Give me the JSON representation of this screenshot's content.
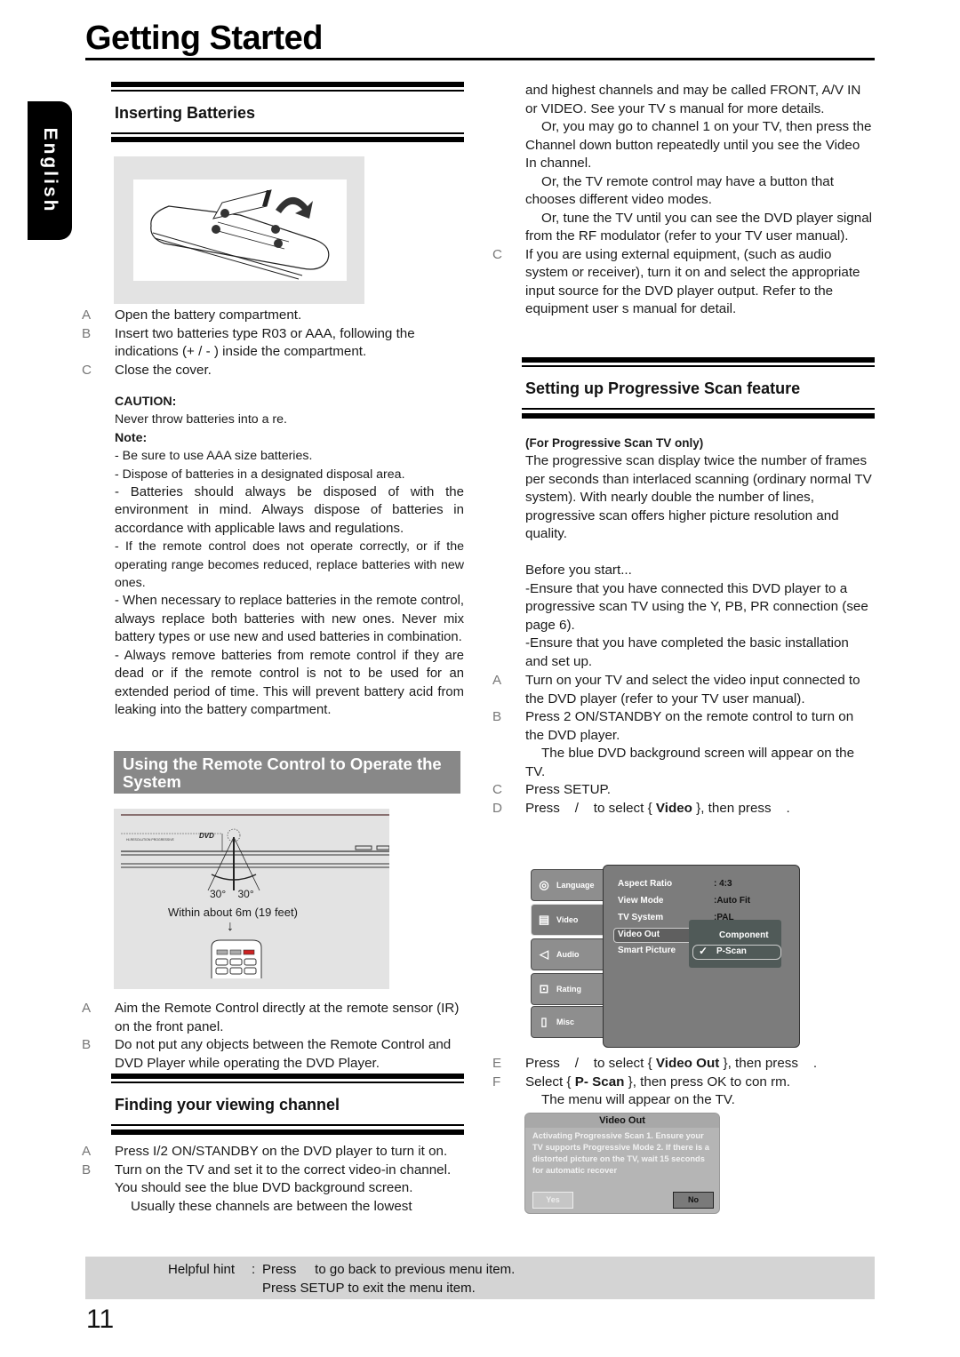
{
  "page": {
    "title": "Getting Started",
    "language_tab": "English",
    "page_number": "11"
  },
  "batteries": {
    "heading": "Inserting Batteries",
    "steps": [
      {
        "letter": "A",
        "text": "Open the battery compartment."
      },
      {
        "letter": "B",
        "text": "Insert two batteries type R03 or AAA, following the indications (+ / - ) inside the compartment."
      },
      {
        "letter": "C",
        "text": "Close the cover."
      }
    ],
    "caution_label": "CAUTION:",
    "caution_text": "Never throw batteries into a  re.",
    "note_label": "Note:",
    "notes": [
      "- Be sure to use AAA size batteries.",
      "- Dispose of batteries in a designated disposal area.",
      "- Batteries should always be disposed of with the environment in mind. Always dispose of batteries in accordance with applicable laws and regulations.",
      "- If the remote control does not operate correctly, or if the operating range becomes reduced, replace batteries with new ones.",
      "- When necessary to replace batteries in the remote control, always replace both batteries with new ones. Never mix battery types or use new and used batteries in combination.",
      "- Always remove batteries from remote control if they are dead or if the remote control is not to be used for an extended period of time. This will prevent battery acid from leaking into the battery compartment."
    ]
  },
  "remote": {
    "heading": "Using the Remote Control to Operate the System",
    "figure": {
      "angle_left": "30°",
      "angle_right": "30°",
      "distance": "Within about 6m (19 feet)",
      "arrow": "↓",
      "panel_brand": "HI-RESOLUTION PROGRESSIVE",
      "panel_logo": "DVD"
    },
    "steps": [
      {
        "letter": "A",
        "text": "Aim the Remote Control directly at the remote sensor (IR) on the front panel."
      },
      {
        "letter": "B",
        "text": "Do not put any objects between the Remote Control and DVD Player while operating the DVD Player."
      }
    ]
  },
  "channel": {
    "heading": "Finding your viewing channel",
    "steps": [
      {
        "letter": "A",
        "text": "Press I/2  ON/STANDBY on the DVD player to turn it on."
      },
      {
        "letter": "B",
        "text": "Turn on the TV and set it to the correct video-in channel. You should see the blue DVD background screen."
      }
    ],
    "continued": [
      "Usually these channels are between the lowest",
      "and highest channels and may be called FRONT, A/V IN or VIDEO. See your TV  s manual for more details.",
      "Or, you may go to channel 1 on your TV, then press the Channel down button repeatedly until you see the Video In channel.",
      "Or, the TV remote control may have a button that chooses different video modes.",
      "Or, tune the TV until you can see the DVD player signal from the RF modulator (refer to your TV user manual)."
    ],
    "step_c": {
      "letter": "C",
      "text": "If you are using external equipment, (such as audio  system or receiver), turn it on and select the appropriate input source for the DVD player output. Refer to the equipment user  s manual for detail."
    }
  },
  "progressive": {
    "heading": "Setting up Progressive Scan feature",
    "subheading": "(For Progressive Scan TV only)",
    "intro": "The progressive scan display twice the number of frames per seconds than interlaced scanning (ordinary normal TV system). With nearly double the number of lines, progressive scan offers higher picture resolution and quality.",
    "before_label": "Before you start...",
    "before": [
      "-Ensure that you have connected this DVD player to a progressive scan TV using the Y, PB, PR connection (see page 6).",
      "-Ensure that you have completed the basic installation and set up."
    ],
    "steps": [
      {
        "letter": "A",
        "text": "Turn on your TV and select the video input connected to the DVD player (refer to your TV user manual)."
      },
      {
        "letter": "B",
        "text": "Press 2  ON/STANDBY on the remote control to turn on the DVD player."
      },
      {
        "letter": "",
        "text": "The blue DVD background screen will appear on the TV."
      },
      {
        "letter": "C",
        "text": "Press SETUP."
      },
      {
        "letter": "D",
        "pre": "Press    /    to select { ",
        "bold": "Video",
        "post": " }, then press    ."
      },
      {
        "letter": "E",
        "pre": "Press    /    to select { ",
        "bold": "Video Out",
        "post": " }, then press    ."
      },
      {
        "letter": "F",
        "pre": "Select { ",
        "bold": "P- Scan",
        "post": " }, then press OK to con rm."
      },
      {
        "letter": "",
        "text": "The menu will appear on the TV."
      }
    ]
  },
  "dvd_menu": {
    "tabs": [
      {
        "label": "Language",
        "icon": "disc-icon"
      },
      {
        "label": "Video",
        "icon": "clapperboard-icon",
        "active": true
      },
      {
        "label": "Audio",
        "icon": "speaker-icon"
      },
      {
        "label": "Rating",
        "icon": "lock-icon"
      },
      {
        "label": "Misc",
        "icon": "document-icon"
      }
    ],
    "rows": [
      {
        "label": "Aspect Ratio",
        "value": ": 4:3"
      },
      {
        "label": "View Mode",
        "value": ":Auto Fit"
      },
      {
        "label": "TV System",
        "value": ":PAL"
      },
      {
        "label": "Video Out",
        "value": ""
      },
      {
        "label": "Smart Picture",
        "value": ""
      }
    ],
    "submenu": {
      "options": [
        "Component",
        "P-Scan"
      ],
      "selected": "P-Scan",
      "check": "✓"
    }
  },
  "dialog": {
    "title": "Video Out",
    "message": "Activating Progressive Scan 1. Ensure your TV supports Progressive Mode 2. If there is a distorted picture on the TV, wait 15 seconds for automatic recover",
    "yes_label": "Yes",
    "no_label": "No"
  },
  "hint": {
    "label": "Helpful hint",
    "colon": ":",
    "line1": "Press     to go back to previous menu item.",
    "line2": "Press SETUP to exit the menu item."
  }
}
